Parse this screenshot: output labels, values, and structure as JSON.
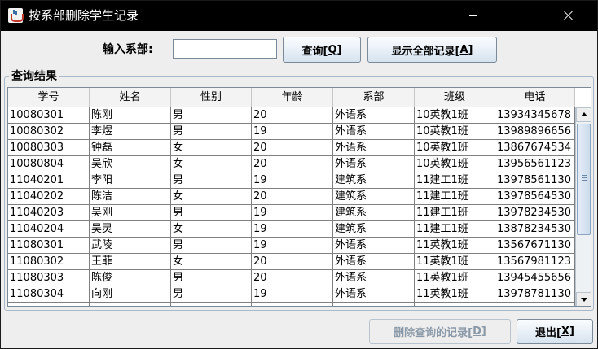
{
  "window": {
    "title": "按系部删除学生记录"
  },
  "query": {
    "dept_label": "输入系部:",
    "dept_value": "",
    "query_button": {
      "text": "查询[",
      "key": "Q",
      "end": "]"
    },
    "show_all_button": {
      "text": "显示全部记录[",
      "key": "A",
      "end": "]"
    }
  },
  "results": {
    "group_title": "查询结果",
    "columns": [
      "学号",
      "姓名",
      "性别",
      "年龄",
      "系部",
      "班级",
      "电话"
    ],
    "rows": [
      [
        "10080301",
        "陈刚",
        "男",
        "20",
        "外语系",
        "10英教1班",
        "13934345678"
      ],
      [
        "10080302",
        "李煜",
        "男",
        "19",
        "外语系",
        "10英教1班",
        "13989896656"
      ],
      [
        "10080303",
        "钟磊",
        "女",
        "20",
        "外语系",
        "10英教1班",
        "13867674534"
      ],
      [
        "10080804",
        "吴欣",
        "女",
        "20",
        "外语系",
        "10英教1班",
        "13956561123"
      ],
      [
        "11040201",
        "李阳",
        "男",
        "19",
        "建筑系",
        "11建工1班",
        "13978561130"
      ],
      [
        "11040202",
        "陈洁",
        "女",
        "20",
        "建筑系",
        "11建工1班",
        "13978564530"
      ],
      [
        "11040203",
        "吴刚",
        "男",
        "19",
        "建筑系",
        "11建工1班",
        "13978234530"
      ],
      [
        "11040204",
        "吴灵",
        "女",
        "19",
        "建筑系",
        "11建工1班",
        "13878234530"
      ],
      [
        "11080301",
        "武陵",
        "男",
        "19",
        "外语系",
        "11英教1班",
        "13567671130"
      ],
      [
        "11080302",
        "王菲",
        "女",
        "20",
        "外语系",
        "11英教1班",
        "13567981123"
      ],
      [
        "11080303",
        "陈俊",
        "男",
        "20",
        "外语系",
        "11英教1班",
        "13945455656"
      ],
      [
        "11080304",
        "向刚",
        "男",
        "19",
        "外语系",
        "11英教1班",
        "13978781130"
      ],
      [
        "",
        "",
        "",
        "",
        "",
        "",
        ""
      ]
    ]
  },
  "footer": {
    "delete_button": {
      "text": "删除查询的记录[",
      "key": "D",
      "end": "]"
    },
    "exit_button": {
      "text": "退出[",
      "key": "X",
      "end": "]"
    }
  }
}
